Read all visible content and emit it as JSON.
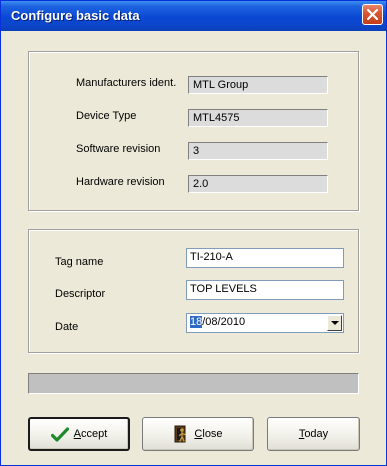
{
  "window": {
    "title": "Configure basic data"
  },
  "device_info": {
    "rows": [
      {
        "label": "Manufacturers ident.",
        "value": "MTL Group"
      },
      {
        "label": "Device Type",
        "value": "MTL4575"
      },
      {
        "label": "Software revision",
        "value": "3"
      },
      {
        "label": "Hardware revision",
        "value": "2.0"
      }
    ]
  },
  "edit_fields": {
    "tag_name": {
      "label": "Tag name",
      "value": "TI-210-A"
    },
    "descriptor": {
      "label": "Descriptor",
      "value": "TOP LEVELS"
    },
    "date": {
      "label": "Date",
      "value_selected": "18",
      "value_rest": "/08/2010"
    }
  },
  "progress": {
    "fraction": 0
  },
  "buttons": {
    "accept": {
      "accel": "A",
      "rest": "ccept"
    },
    "close": {
      "accel": "C",
      "rest": "lose"
    },
    "today": {
      "accel": "T",
      "rest": "oday"
    }
  },
  "icons": {
    "accept": "checkmark-icon",
    "close": "door-person-icon",
    "window_close": "close-icon",
    "dropdown": "chevron-down-icon"
  },
  "colors": {
    "titlebar": "#0a48d4",
    "dialog_bg": "#ece9d8",
    "selection": "#316ac5",
    "close_button": "#d9542f"
  }
}
